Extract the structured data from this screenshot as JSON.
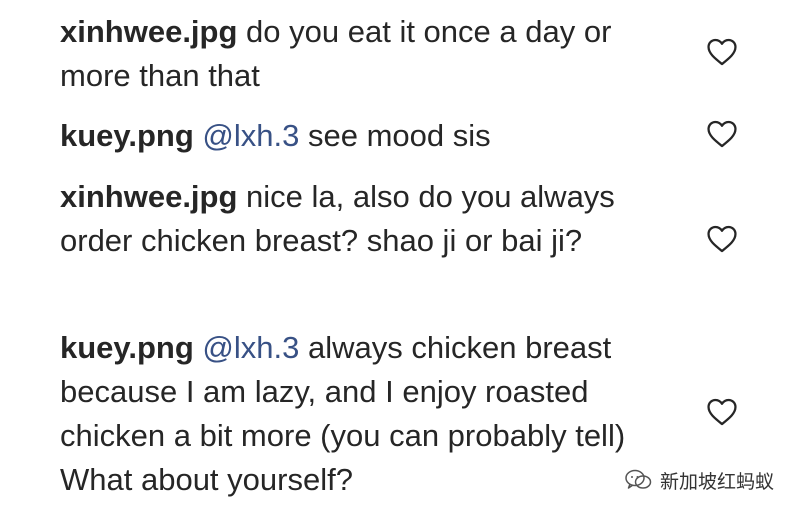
{
  "comments": [
    {
      "username": "xinhwee.jpg",
      "mention": "",
      "text": "do you eat it once a day or more than that",
      "like_icon": "heart-outline-icon"
    },
    {
      "username": "kuey.png",
      "mention": "@lxh.3",
      "text": "see mood sis",
      "like_icon": "heart-outline-icon"
    },
    {
      "username": "xinhwee.jpg",
      "mention": "",
      "text": "nice la, also do you always order chicken breast? shao ji or bai ji?",
      "like_icon": "heart-outline-icon"
    },
    {
      "username": "kuey.png",
      "mention": "@lxh.3",
      "text": "always chicken breast because I am lazy, and I enjoy roasted chicken a bit more (you can probably tell) What about yourself?",
      "like_icon": "heart-outline-icon"
    }
  ],
  "watermark": {
    "text": "新加坡红蚂蚁",
    "icon": "wechat-logo-icon"
  },
  "colors": {
    "text": "#262626",
    "mention": "#385185",
    "icon_stroke": "#262626"
  }
}
